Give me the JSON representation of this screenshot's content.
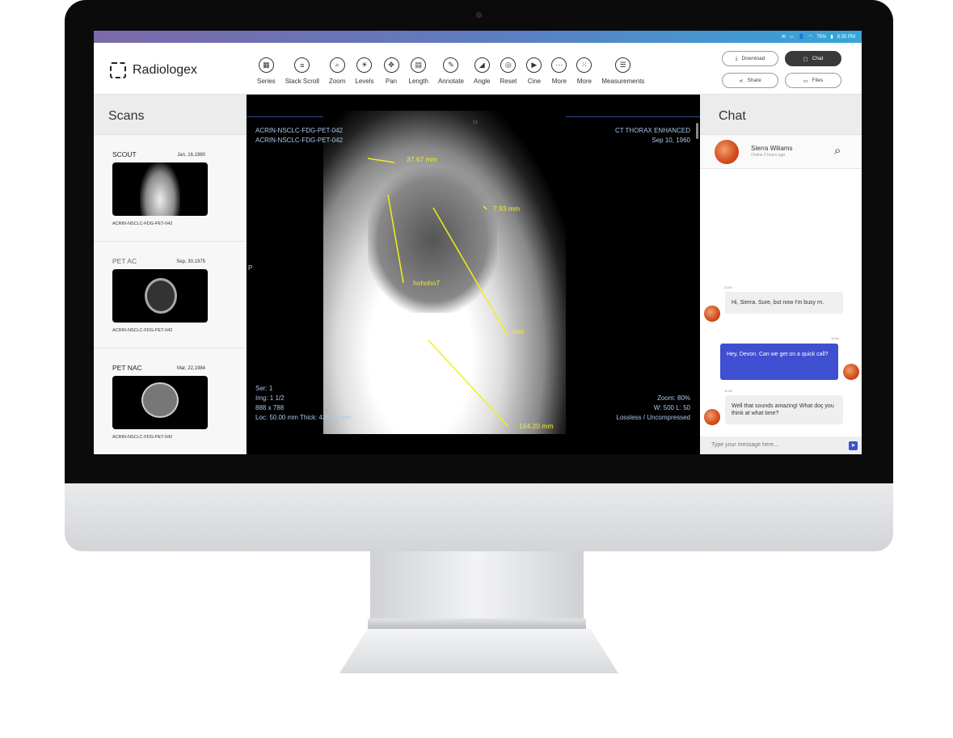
{
  "status_bar": {
    "time": "8:35 PM",
    "battery": "75%"
  },
  "app": {
    "name": "Radiologex"
  },
  "toolbar": [
    {
      "label": "Series",
      "icon": "grid-icon"
    },
    {
      "label": "Stack Scroll",
      "icon": "stack-icon"
    },
    {
      "label": "Zoom",
      "icon": "magnifier-icon"
    },
    {
      "label": "Levels",
      "icon": "sun-icon"
    },
    {
      "label": "Pan",
      "icon": "move-icon"
    },
    {
      "label": "Length",
      "icon": "ruler-icon"
    },
    {
      "label": "Annotate",
      "icon": "note-icon"
    },
    {
      "label": "Angle",
      "icon": "angle-icon"
    },
    {
      "label": "Reset",
      "icon": "reset-icon"
    },
    {
      "label": "Cine",
      "icon": "play-icon"
    },
    {
      "label": "More",
      "icon": "dots-icon"
    },
    {
      "label": "More",
      "icon": "apps-icon"
    },
    {
      "label": "Measurements",
      "icon": "list-icon"
    }
  ],
  "actions": {
    "download": "Download",
    "chat": "Chat",
    "share": "Share",
    "files": "Files"
  },
  "scans": {
    "title": "Scans",
    "items": [
      {
        "name": "SCOUT",
        "date": "Jan, 16,1960",
        "id": "ACRIN-NSCLC-FDG-PET-042"
      },
      {
        "name": "PET AC",
        "date": "Sep, 30,1975",
        "id": "ACRIN-NSCLC-FDG-PET-042"
      },
      {
        "name": "PET NAC",
        "date": "Mar, 22,1984",
        "id": "ACRIN-NSCLC-FDG-PET-042"
      }
    ]
  },
  "viewer": {
    "top_left": [
      "ACRIN-NSCLC-FDG-PET-042",
      "ACRIN-NSCLC-FDG-PET-042"
    ],
    "top_right": [
      "CT THORAX ENHANCED",
      "Sep 10, 1960"
    ],
    "bottom_left": [
      "Ser: 1",
      "Img: 1 1/2",
      "888 x 788",
      "Loc: 50.00 mm Thick: 430.18 mm"
    ],
    "bottom_right": [
      "Zoom: 80%",
      "W: 500 L: 50",
      "Lossless / Uncompressed"
    ],
    "orientation_top": "H",
    "orientation_left": "P",
    "annotations": [
      "37.67 mm",
      "7.93 mm",
      "hohoho7",
      "test",
      "164.20 mm"
    ],
    "annotation_color": "#f2ef1a"
  },
  "chat": {
    "title": "Chat",
    "contact": {
      "name": "Sierra Wiliams",
      "status": "Online 2 hours ago"
    },
    "messages": [
      {
        "time": "11:50",
        "text": "Hi, Sierra. Sure, but now I'm busy rn.",
        "from": "other"
      },
      {
        "time": "11:50",
        "text": "Hey, Devon. Can we get on a quick call?",
        "from": "me"
      },
      {
        "time": "11:50",
        "text": "Well that sounds amazing! What doç you think at what time?",
        "from": "other"
      }
    ],
    "placeholder": "Type your message here...",
    "accent": "#3f4fd1"
  }
}
